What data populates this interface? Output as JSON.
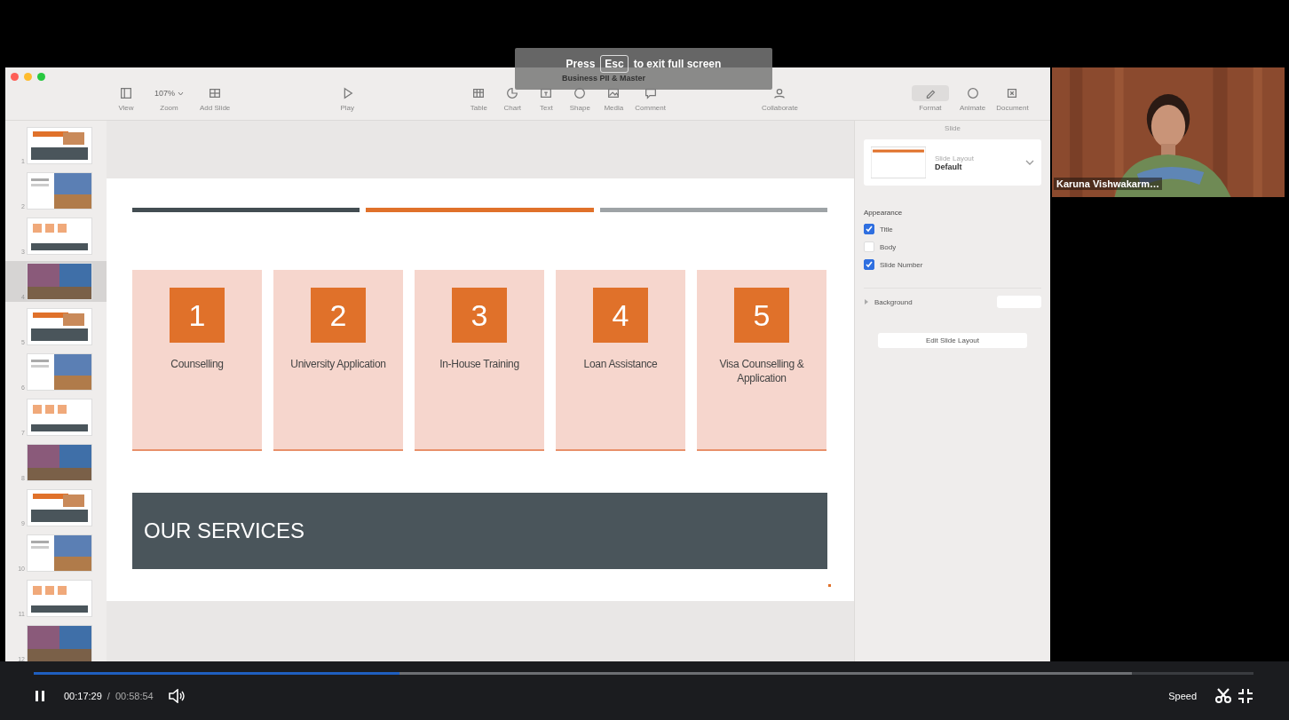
{
  "window": {
    "title": "Business PII & Master"
  },
  "fullscreen_notice": {
    "before": "Press",
    "key": "Esc",
    "after": "to exit full screen"
  },
  "toolbar": {
    "groups": [
      [
        {
          "label": "View"
        },
        {
          "label": "Zoom",
          "value": "107%"
        },
        {
          "label": "Add Slide"
        }
      ],
      [
        {
          "label": "Play"
        }
      ],
      [
        {
          "label": "Table"
        },
        {
          "label": "Chart"
        },
        {
          "label": "Text"
        },
        {
          "label": "Shape"
        },
        {
          "label": "Media"
        },
        {
          "label": "Comment"
        }
      ],
      [
        {
          "label": "Collaborate"
        }
      ],
      [
        {
          "label": "Format",
          "selected": true
        },
        {
          "label": "Animate",
          "selected": false
        },
        {
          "label": "Document",
          "selected": false
        }
      ]
    ]
  },
  "navigator": {
    "slides": [
      {
        "number": "1",
        "selected": false
      },
      {
        "number": "2",
        "selected": false
      },
      {
        "number": "3",
        "selected": false
      },
      {
        "number": "4",
        "selected": true
      },
      {
        "number": "5",
        "selected": false
      },
      {
        "number": "6",
        "selected": false
      },
      {
        "number": "7",
        "selected": false
      },
      {
        "number": "8",
        "selected": false
      },
      {
        "number": "9",
        "selected": false
      },
      {
        "number": "10",
        "selected": false
      },
      {
        "number": "11",
        "selected": false
      },
      {
        "number": "12",
        "selected": false
      }
    ]
  },
  "slide": {
    "services": [
      {
        "number": "1",
        "label": "Counselling"
      },
      {
        "number": "2",
        "label": "University Application"
      },
      {
        "number": "3",
        "label": "In-House Training"
      },
      {
        "number": "4",
        "label": "Loan Assistance"
      },
      {
        "number": "5",
        "label": "Visa Counselling & Application"
      }
    ],
    "banner": "OUR SERVICES"
  },
  "inspector": {
    "header": "Slide",
    "layout_caption": "Slide Layout",
    "layout_name": "Default",
    "appearance_heading": "Appearance",
    "options": [
      {
        "label": "Title",
        "checked": true
      },
      {
        "label": "Body",
        "checked": false
      },
      {
        "label": "Slide Number",
        "checked": true
      }
    ],
    "background_label": "Background",
    "edit_button": "Edit Slide Layout"
  },
  "webcam": {
    "name": "Karuna Vishwakarm…"
  },
  "player": {
    "current": "00:17:29",
    "separator": "/",
    "duration": "00:58:54",
    "level": 0.3,
    "speed": "Speed",
    "playing": true
  }
}
